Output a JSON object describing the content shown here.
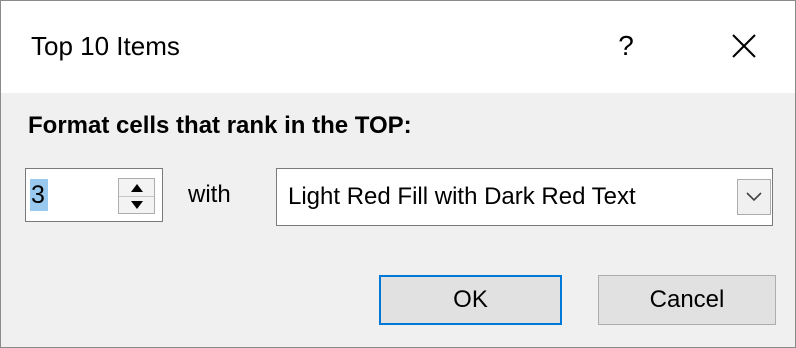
{
  "window": {
    "title": "Top 10 Items",
    "help_label": "?"
  },
  "form": {
    "prompt": "Format cells that rank in the TOP:",
    "rank_count": "3",
    "with_label": "with",
    "format_selected": "Light Red Fill with Dark Red Text"
  },
  "buttons": {
    "ok": "OK",
    "cancel": "Cancel"
  },
  "colors": {
    "dialog_bg": "#f0f0f0",
    "titlebar_bg": "#ffffff",
    "focus_border": "#0078d7",
    "selection_highlight": "#99c9ef"
  },
  "icons": {
    "close": "close-icon",
    "spin_up": "triangle-up-icon",
    "spin_down": "triangle-down-icon",
    "dropdown": "chevron-down-icon"
  }
}
